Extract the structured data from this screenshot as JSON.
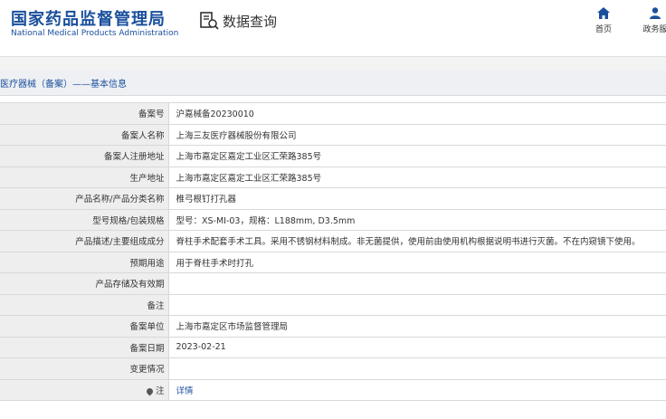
{
  "header": {
    "logo_cn": "国家药品监督管理局",
    "logo_en": "National Medical Products Administration",
    "query_title": "数据查询",
    "query_icon": "search-document-icon",
    "nav": [
      {
        "label": "首页",
        "icon": "home-icon"
      },
      {
        "label": "政务服",
        "icon": "user-icon"
      }
    ]
  },
  "breadcrumb": "医疗器械（备案）——基本信息",
  "rows": [
    {
      "key": "备案号",
      "value": "沪嘉械备20230010"
    },
    {
      "key": "备案人名称",
      "value": "上海三友医疗器械股份有限公司"
    },
    {
      "key": "备案人注册地址",
      "value": "上海市嘉定区嘉定工业区汇荣路385号"
    },
    {
      "key": "生产地址",
      "value": "上海市嘉定区嘉定工业区汇荣路385号"
    },
    {
      "key": "产品名称/产品分类名称",
      "value": "椎弓根钉打孔器"
    },
    {
      "key": "型号规格/包装规格",
      "value": "型号：XS-MI-03，规格：L188mm, D3.5mm"
    },
    {
      "key": "产品描述/主要组成成分",
      "value": "脊柱手术配套手术工具。采用不锈钢材料制成。非无菌提供，使用前由使用机构根据说明书进行灭菌。不在内窥镜下使用。"
    },
    {
      "key": "预期用途",
      "value": "用于脊柱手术时打孔"
    },
    {
      "key": "产品存储及有效期",
      "value": ""
    },
    {
      "key": "备注",
      "value": ""
    },
    {
      "key": "备案单位",
      "value": "上海市嘉定区市场监督管理局"
    },
    {
      "key": "备案日期",
      "value": "2023-02-21"
    },
    {
      "key": "变更情况",
      "value": ""
    },
    {
      "key": "注",
      "value": "详情",
      "icon": "pin-icon"
    }
  ],
  "colors": {
    "brand": "#1a4f9c",
    "label_bg": "#eeeeee",
    "crumb_bg": "#eef0f4"
  }
}
